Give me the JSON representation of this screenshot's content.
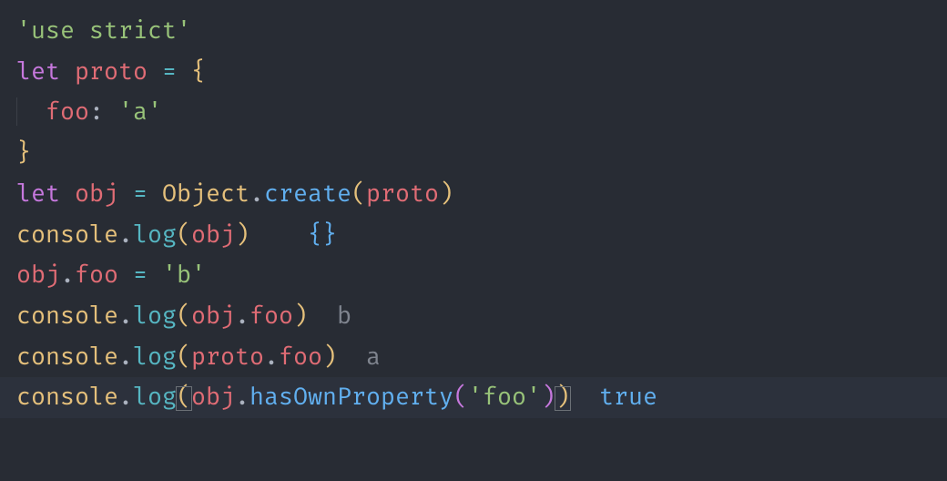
{
  "code": {
    "line1": {
      "str": "'use strict'"
    },
    "line2": {
      "kw": "let",
      "var": "proto",
      "op": "=",
      "brace": "{"
    },
    "line3": {
      "indent": "  ",
      "prop": "foo",
      "colon": ":",
      "str": "'a'"
    },
    "line4": {
      "brace": "}"
    },
    "line6": {
      "kw": "let",
      "var": "obj",
      "op": "=",
      "class": "Object",
      "dot": ".",
      "fn": "create",
      "lp": "(",
      "arg": "proto",
      "rp": ")"
    },
    "line7": {
      "obj": "console",
      "dot": ".",
      "fn": "log",
      "lp": "(",
      "arg": "obj",
      "rp": ")",
      "sp": "    ",
      "outL": "{",
      "outR": "}"
    },
    "line8": {
      "obj": "obj",
      "dot1": ".",
      "prop": "foo",
      "op": "=",
      "str": "'b'"
    },
    "line9": {
      "obj": "console",
      "dot": ".",
      "fn": "log",
      "lp": "(",
      "arg1": "obj",
      "dot2": ".",
      "arg2": "foo",
      "rp": ")",
      "sp": "  ",
      "out": "b"
    },
    "line10": {
      "obj": "console",
      "dot": ".",
      "fn": "log",
      "lp": "(",
      "arg1": "proto",
      "dot2": ".",
      "arg2": "foo",
      "rp": ")",
      "sp": "  ",
      "out": "a"
    },
    "line11": {
      "obj": "console",
      "dot": ".",
      "fn": "log",
      "lp": "(",
      "arg1": "obj",
      "dot2": ".",
      "method": "hasOwnProperty",
      "lp2": "(",
      "str": "'foo'",
      "rp2": ")",
      "rp": ")",
      "sp": "  ",
      "out": "true"
    }
  }
}
